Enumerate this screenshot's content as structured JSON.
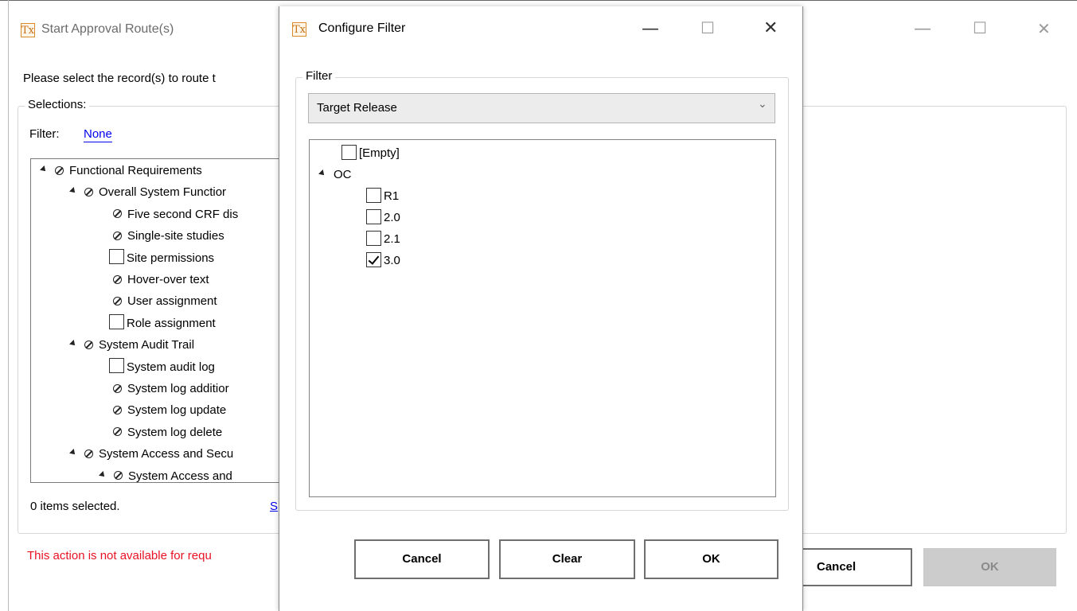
{
  "background_window": {
    "title": "Start Approval Route(s)",
    "instruction": "Please select the record(s) to route t",
    "selections_legend": "Selections:",
    "filter_label": "Filter:",
    "filter_value": "None",
    "tree": [
      {
        "label": "Functional Requirements",
        "level": 0,
        "expander": true,
        "marker": "none"
      },
      {
        "label": "Overall System Functior",
        "level": 1,
        "expander": true,
        "marker": "none"
      },
      {
        "label": "Five second CRF dis",
        "level": 2,
        "expander": false,
        "marker": "none"
      },
      {
        "label": "Single-site studies",
        "level": 2,
        "expander": false,
        "marker": "none"
      },
      {
        "label": "Site permissions",
        "level": 2,
        "expander": false,
        "marker": "checkbox"
      },
      {
        "label": "Hover-over text",
        "level": 2,
        "expander": false,
        "marker": "none"
      },
      {
        "label": "User assignment",
        "level": 2,
        "expander": false,
        "marker": "none"
      },
      {
        "label": "Role assignment",
        "level": 2,
        "expander": false,
        "marker": "checkbox"
      },
      {
        "label": "System Audit Trail",
        "level": 1,
        "expander": true,
        "marker": "none"
      },
      {
        "label": "System audit log",
        "level": 2,
        "expander": false,
        "marker": "checkbox"
      },
      {
        "label": "System log additior",
        "level": 2,
        "expander": false,
        "marker": "none"
      },
      {
        "label": "System log update",
        "level": 2,
        "expander": false,
        "marker": "none"
      },
      {
        "label": "System log delete",
        "level": 2,
        "expander": false,
        "marker": "none"
      },
      {
        "label": "System Access and Secu",
        "level": 1,
        "expander": true,
        "marker": "none"
      },
      {
        "label": "System Access and",
        "level": 2,
        "expander": true,
        "marker": "none"
      }
    ],
    "items_selected": "0 items selected.",
    "cut_link": "S",
    "error_text": "This action is not available for requ",
    "cancel_label": "Cancel",
    "ok_label": "OK"
  },
  "dialog": {
    "title": "Configure Filter",
    "filter_legend": "Filter",
    "dropdown_value": "Target Release",
    "tree": [
      {
        "label": "[Empty]",
        "level": 0,
        "type": "checkbox",
        "checked": false
      },
      {
        "label": "OC",
        "level": 0,
        "type": "expander"
      },
      {
        "label": "R1",
        "level": 1,
        "type": "checkbox",
        "checked": false
      },
      {
        "label": "2.0",
        "level": 1,
        "type": "checkbox",
        "checked": false
      },
      {
        "label": "2.1",
        "level": 1,
        "type": "checkbox",
        "checked": false
      },
      {
        "label": "3.0",
        "level": 1,
        "type": "checkbox",
        "checked": true
      }
    ],
    "cancel_label": "Cancel",
    "clear_label": "Clear",
    "ok_label": "OK"
  },
  "icons": {
    "minimize": "—",
    "maximize": "☐",
    "close": "✕",
    "logo": "Tx",
    "chevron": "⌄"
  },
  "colors": {
    "error": "#e81123",
    "link": "#0000ee",
    "logo": "#d98a2b"
  }
}
